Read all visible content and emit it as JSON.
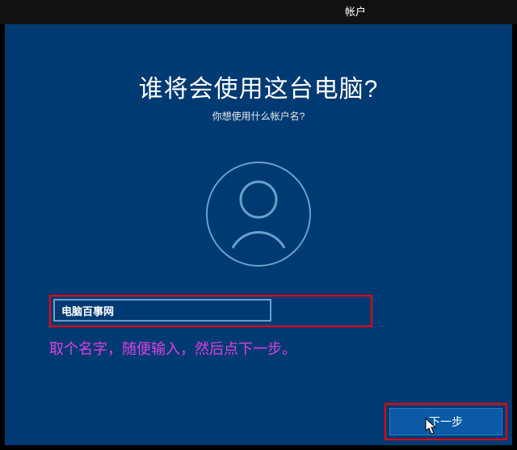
{
  "tab": {
    "label": "帐户"
  },
  "heading": "谁将会使用这台电脑?",
  "subheading": "你想使用什么帐户名?",
  "username": {
    "value": "电脑百事网"
  },
  "annotation": "取个名字，随便输入，然后点下一步。",
  "next_button": {
    "label": "下一步"
  },
  "colors": {
    "panel": "#003a73",
    "highlight_box": "#ff0000",
    "annotation_text": "#e040e0",
    "button": "#0b5aa6"
  }
}
